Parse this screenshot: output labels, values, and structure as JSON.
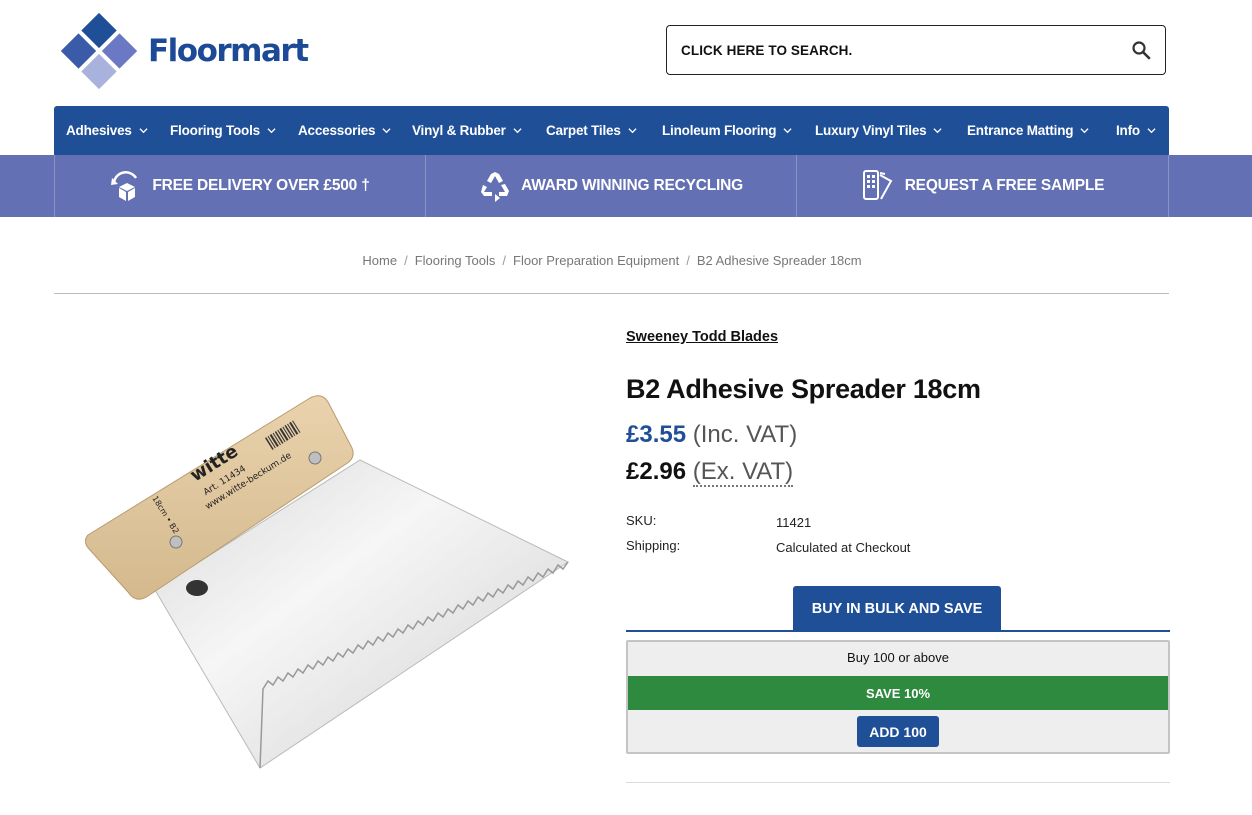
{
  "brand": {
    "name": "Floormart"
  },
  "search": {
    "placeholder": "CLICK HERE TO SEARCH."
  },
  "nav": {
    "items": [
      {
        "label": "Adhesives"
      },
      {
        "label": "Flooring Tools"
      },
      {
        "label": "Accessories"
      },
      {
        "label": "Vinyl & Rubber"
      },
      {
        "label": "Carpet Tiles"
      },
      {
        "label": "Linoleum Flooring"
      },
      {
        "label": "Luxury Vinyl Tiles"
      },
      {
        "label": "Entrance Matting"
      },
      {
        "label": "Info"
      }
    ]
  },
  "benefits": [
    {
      "label": "FREE DELIVERY OVER £500 †",
      "icon": "delivery-box-icon"
    },
    {
      "label": "AWARD WINNING RECYCLING",
      "icon": "recycle-icon"
    },
    {
      "label": "REQUEST A FREE SAMPLE",
      "icon": "sample-swatch-icon"
    }
  ],
  "breadcrumb": [
    {
      "label": "Home"
    },
    {
      "label": "Flooring Tools"
    },
    {
      "label": "Floor Preparation Equipment"
    },
    {
      "label": "B2 Adhesive Spreader 18cm"
    }
  ],
  "product": {
    "brand": "Sweeney Todd Blades",
    "title": "B2 Adhesive Spreader 18cm",
    "price_inc": "£3.55",
    "price_inc_label": "(Inc. VAT)",
    "price_ex": "£2.96",
    "price_ex_label": "(Ex. VAT)",
    "specs": [
      {
        "label": "SKU:",
        "value": "11421"
      },
      {
        "label": "Shipping:",
        "value": "Calculated at Checkout"
      }
    ],
    "image_text": {
      "brand": "witte",
      "art": "Art. 11434",
      "url": "www.witte-beckum.de",
      "size": "18cm • B2"
    }
  },
  "bulk": {
    "tab_label": "BUY IN BULK AND SAVE",
    "quantity_text": "Buy 100 or above",
    "save_text": "SAVE 10%",
    "add_label": "ADD 100"
  },
  "colors": {
    "nav_blue": "#1f4f97",
    "benefit_purple": "#6470b4",
    "save_green": "#2d8a3e"
  }
}
